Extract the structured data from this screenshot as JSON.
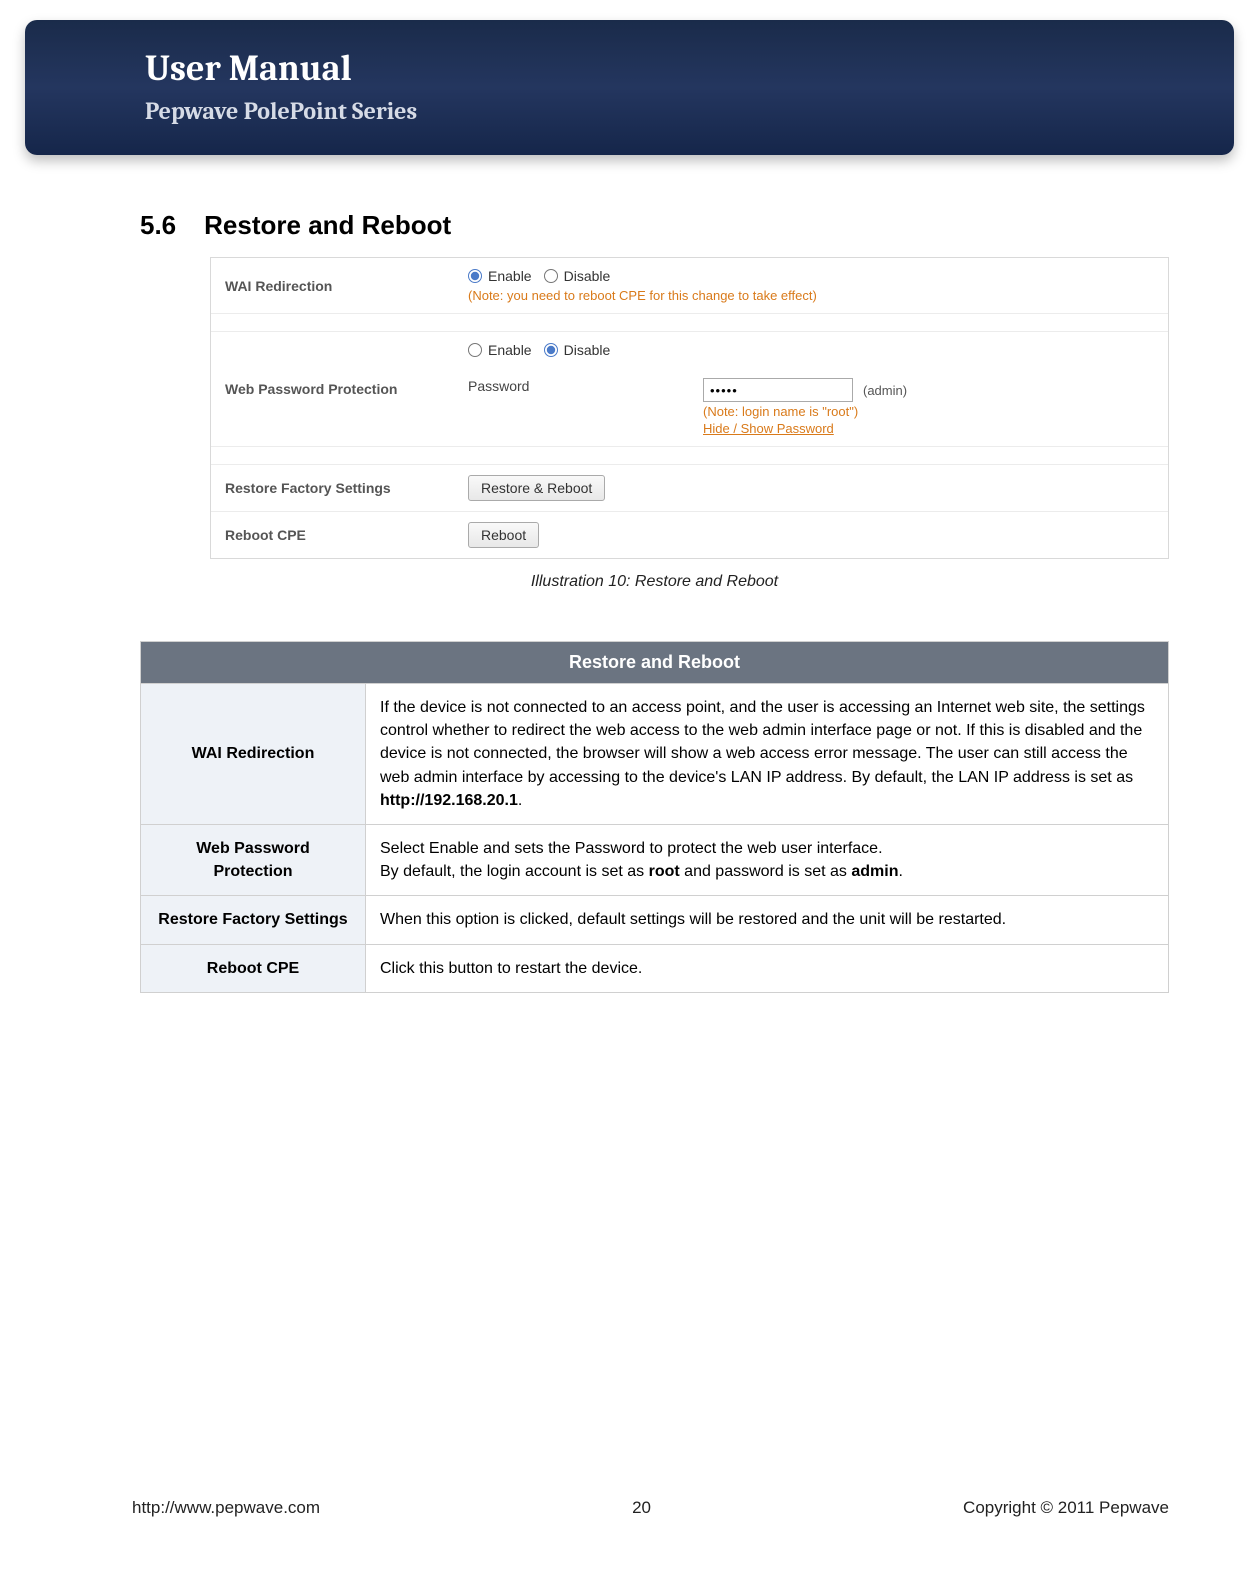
{
  "header": {
    "title": "User Manual",
    "subtitle": "Pepwave PolePoint Series"
  },
  "section": {
    "number": "5.6",
    "title": "Restore and Reboot"
  },
  "illustration": {
    "caption": "Illustration 10: Restore and Reboot",
    "rows": {
      "wai": {
        "label": "WAI Redirection",
        "enable_label": "Enable",
        "disable_label": "Disable",
        "note": "(Note: you need to reboot CPE for this change to take effect)"
      },
      "webpw": {
        "label": "Web Password Protection",
        "enable_label": "Enable",
        "disable_label": "Disable",
        "pw_label": "Password",
        "pw_value": "•••••",
        "admin_hint": "(admin)",
        "root_note": "(Note: login name is \"root\")",
        "link": "Hide / Show Password"
      },
      "restore": {
        "label": "Restore Factory Settings",
        "button": "Restore & Reboot"
      },
      "reboot": {
        "label": "Reboot CPE",
        "button": "Reboot"
      }
    }
  },
  "table": {
    "header": "Restore and Reboot",
    "rows": [
      {
        "label": "WAI Redirection",
        "text_pre": "If the device is not connected to an access point, and the user is accessing an Internet web site, the settings control whether to redirect the web access to the web admin interface page or not.  If this is disabled and the device is not connected, the browser will show a web access error message.  The user can still access the web admin interface by accessing to the device's LAN IP address.  By default, the LAN IP address is set as ",
        "bold": "http://192.168.20.1",
        "text_post": "."
      },
      {
        "label": "Web Password Protection",
        "text_pre": "Select Enable and sets the Password to protect the web user interface.\nBy default, the login account is set as ",
        "bold": "root",
        "mid": " and password is set as ",
        "bold2": "admin",
        "text_post": "."
      },
      {
        "label": "Restore Factory Settings",
        "text_pre": "When this option is clicked, default settings will be restored and the unit will be restarted.",
        "bold": "",
        "text_post": ""
      },
      {
        "label": "Reboot CPE",
        "text_pre": "Click this button to restart the device.",
        "bold": "",
        "text_post": ""
      }
    ]
  },
  "footer": {
    "url": "http://www.pepwave.com",
    "page": "20",
    "copyright": "Copyright © 2011 Pepwave"
  }
}
